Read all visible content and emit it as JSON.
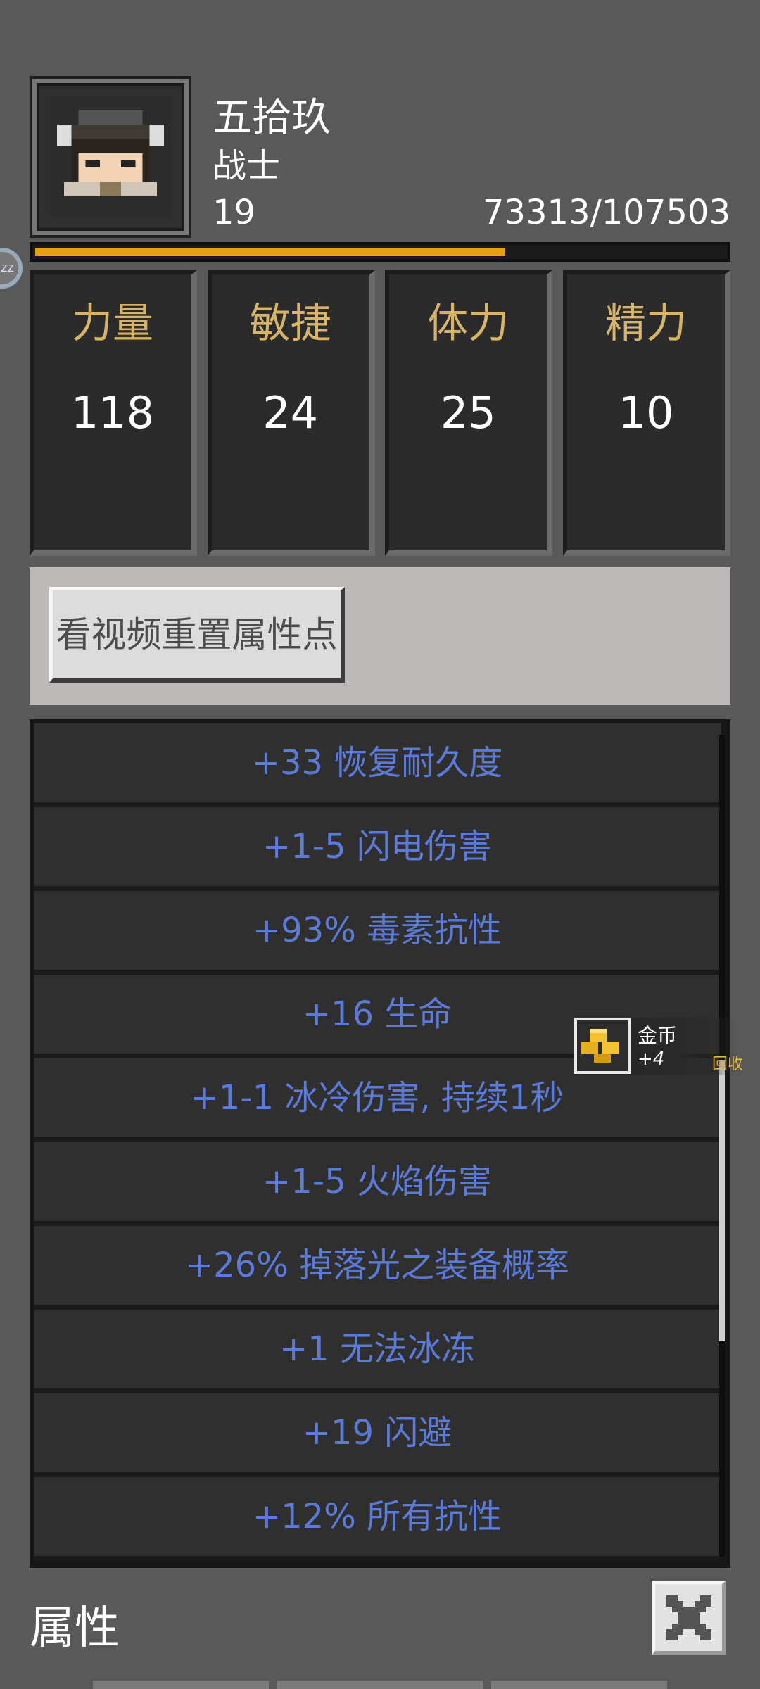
{
  "player": {
    "name": "五拾玖",
    "class": "战士",
    "level": "19",
    "xp_text": "73313/107503",
    "xp_progress": 0.682
  },
  "stats": [
    {
      "label": "力量",
      "value": "118"
    },
    {
      "label": "敏捷",
      "value": "24"
    },
    {
      "label": "体力",
      "value": "25"
    },
    {
      "label": "精力",
      "value": "10"
    }
  ],
  "reset_button_label": "看视频重置属性点",
  "attributes": [
    "+33 恢复耐久度",
    "+1-5 闪电伤害",
    "+93% 毒素抗性",
    "+16 生命",
    "+1-1 冰冷伤害, 持续1秒",
    "+1-5 火焰伤害",
    "+26% 掉落光之装备概率",
    "+1 无法冰冻",
    "+19 闪避",
    "+12% 所有抗性"
  ],
  "toast": {
    "item_name": "金币",
    "amount": "+4",
    "action": "回收",
    "icon": "gold-coins-icon"
  },
  "sleep_badge": "zz",
  "footer": {
    "title": "属性",
    "close_icon": "close-icon"
  },
  "colors": {
    "background": "#595959",
    "stat_label": "#d7b46a",
    "attribute_text": "#5c7bd9",
    "xp_fill": "#e8a013"
  }
}
